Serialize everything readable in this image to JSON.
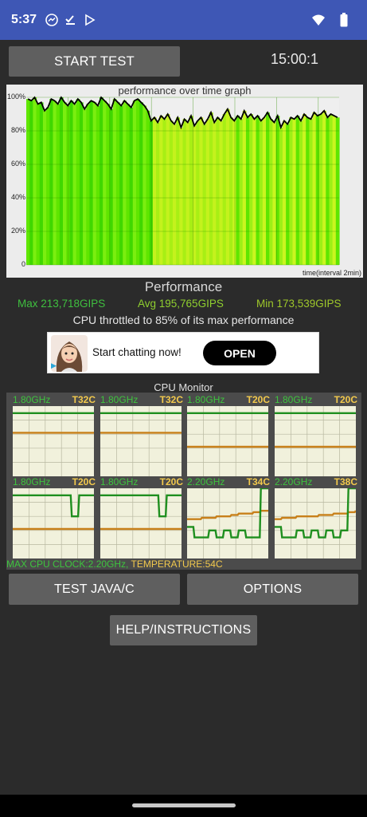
{
  "status": {
    "time": "5:37",
    "left_icons": [
      "messenger-icon",
      "download-done-icon",
      "play-store-icon"
    ],
    "right_icons": [
      "wifi-icon",
      "battery-icon"
    ]
  },
  "controls": {
    "start_label": "START TEST",
    "timer": "15:00:1"
  },
  "graph": {
    "title": "performance over time graph",
    "y_ticks": [
      "100%",
      "80%",
      "60%",
      "40%",
      "20%",
      "0"
    ],
    "x_label": "time(interval 2min)",
    "colors": {
      "green": "#43dd00",
      "yellow_green": "#b6f21a",
      "line": "#000000",
      "bg": "#ececec"
    }
  },
  "chart_data": {
    "type": "line",
    "title": "performance over time graph",
    "xlabel": "time(interval 2min)",
    "ylabel": "",
    "ylim": [
      0,
      100
    ],
    "y_ticks": [
      0,
      20,
      40,
      60,
      80,
      100
    ],
    "series": [
      {
        "values": [
          99,
          98,
          100,
          96,
          97,
          92,
          94,
          99,
          98,
          96,
          100,
          97,
          95,
          98,
          96,
          99,
          97,
          93,
          96,
          98,
          97,
          95,
          100,
          98,
          96,
          93,
          99,
          97,
          95,
          98,
          96,
          94,
          98,
          99,
          97,
          95,
          92,
          86,
          88,
          85,
          89,
          87,
          90,
          86,
          84,
          88,
          82,
          87,
          85,
          89,
          83,
          86,
          88,
          84,
          87,
          91,
          85,
          88,
          86,
          90,
          93,
          88,
          86,
          89,
          87,
          92,
          88,
          90,
          87,
          89,
          86,
          88,
          91,
          87,
          85,
          89,
          82,
          86,
          84,
          88,
          87,
          89,
          86,
          90,
          88,
          87,
          91,
          89,
          90,
          92,
          88,
          90,
          89,
          88
        ]
      }
    ]
  },
  "performance": {
    "title": "Performance",
    "max": "Max 213,718GIPS",
    "avg": "Avg 195,765GIPS",
    "min": "Min 173,539GIPS",
    "throttle": "CPU throttled to 85% of its max performance",
    "max_color": "#3fbf3f",
    "avg_color": "#8fcf2f",
    "min_color": "#9fc82a"
  },
  "ad": {
    "text": "Start chatting now!",
    "button": "OPEN"
  },
  "cpu_monitor": {
    "title": "CPU Monitor",
    "cores": [
      {
        "freq": "1.80GHz",
        "temp": "T32C",
        "clock": [
          90,
          90,
          90,
          90,
          90,
          90,
          90,
          90,
          90,
          90,
          90,
          90
        ],
        "temperature": [
          62,
          62,
          62,
          62,
          62,
          62,
          62,
          62,
          62,
          62,
          62,
          62
        ]
      },
      {
        "freq": "1.80GHz",
        "temp": "T32C",
        "clock": [
          90,
          90,
          90,
          90,
          90,
          90,
          90,
          90,
          90,
          90,
          90,
          90
        ],
        "temperature": [
          62,
          62,
          62,
          62,
          62,
          62,
          62,
          62,
          62,
          62,
          62,
          62
        ]
      },
      {
        "freq": "1.80GHz",
        "temp": "T20C",
        "clock": [
          90,
          90,
          90,
          90,
          90,
          90,
          90,
          90,
          90,
          90,
          90,
          90
        ],
        "temperature": [
          42,
          42,
          42,
          42,
          42,
          42,
          42,
          42,
          42,
          42,
          42,
          42
        ]
      },
      {
        "freq": "1.80GHz",
        "temp": "T20C",
        "clock": [
          90,
          90,
          90,
          90,
          90,
          90,
          90,
          90,
          90,
          90,
          90,
          90
        ],
        "temperature": [
          42,
          42,
          42,
          42,
          42,
          42,
          42,
          42,
          42,
          42,
          42,
          42
        ]
      },
      {
        "freq": "1.80GHz",
        "temp": "T20C",
        "clock": [
          90,
          90,
          90,
          90,
          90,
          90,
          90,
          90,
          60,
          90,
          90,
          90
        ],
        "temperature": [
          42,
          42,
          42,
          42,
          42,
          42,
          42,
          42,
          42,
          42,
          42,
          42
        ]
      },
      {
        "freq": "1.80GHz",
        "temp": "T20C",
        "clock": [
          90,
          90,
          90,
          90,
          90,
          90,
          90,
          90,
          60,
          90,
          90,
          90
        ],
        "temperature": [
          42,
          42,
          42,
          42,
          42,
          42,
          42,
          42,
          42,
          42,
          42,
          42
        ]
      },
      {
        "freq": "2.20GHz",
        "temp": "T34C",
        "clock": [
          45,
          30,
          30,
          40,
          30,
          40,
          30,
          40,
          30,
          30,
          100,
          100
        ],
        "temperature": [
          56,
          56,
          58,
          58,
          60,
          60,
          62,
          64,
          64,
          66,
          68,
          68
        ]
      },
      {
        "freq": "2.20GHz",
        "temp": "T38C",
        "clock": [
          45,
          30,
          30,
          40,
          30,
          40,
          30,
          40,
          30,
          40,
          100,
          100
        ],
        "temperature": [
          56,
          58,
          58,
          60,
          60,
          60,
          62,
          62,
          64,
          64,
          66,
          68
        ]
      }
    ],
    "max_clock_text": "MAX CPU CLOCK:2.20GHz,",
    "max_temp_text": "TEMPERATURE:54C",
    "colors": {
      "freq": "#3ec43e",
      "temp": "#f2c94c",
      "clock_line": "#1f8f1f",
      "temp_line": "#c8801a",
      "bg": "#f1f1dc",
      "grid": "#b8b8a0"
    }
  },
  "buttons": {
    "java": "TEST JAVA/C",
    "options": "OPTIONS",
    "help": "HELP/INSTRUCTIONS"
  }
}
